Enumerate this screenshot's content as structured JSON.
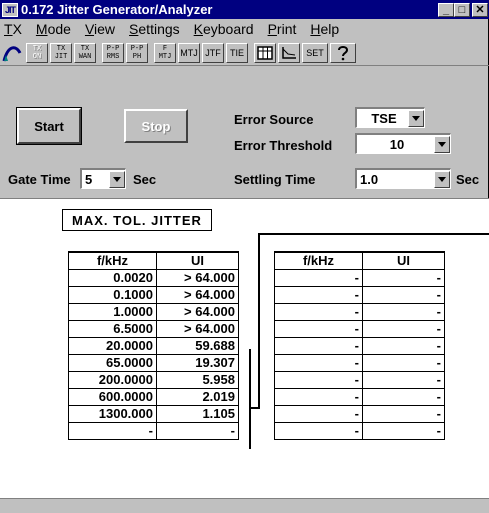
{
  "window": {
    "icon_text": "JIT",
    "title": "0.172 Jitter Generator/Analyzer"
  },
  "menu": {
    "items": [
      {
        "label": "TX"
      },
      {
        "label": "Mode"
      },
      {
        "label": "View"
      },
      {
        "label": "Settings"
      },
      {
        "label": "Keyboard"
      },
      {
        "label": "Print"
      },
      {
        "label": "Help"
      }
    ]
  },
  "toolbar": {
    "buttons": [
      {
        "line1": "TX",
        "line2": "ON",
        "disabled": true
      },
      {
        "line1": "TX",
        "line2": "JIT",
        "disabled": false
      },
      {
        "line1": "TX",
        "line2": "WAN",
        "disabled": false
      },
      {
        "line1": "P-P",
        "line2": "RMS",
        "disabled": false
      },
      {
        "line1": "P-P",
        "line2": "PH",
        "disabled": false
      },
      {
        "line1": "F",
        "line2": "MTJ",
        "disabled": false
      },
      {
        "line1": "",
        "line2": "MTJ",
        "disabled": false
      },
      {
        "line1": "",
        "line2": "JTF",
        "disabled": false
      },
      {
        "line1": "",
        "line2": "TIE",
        "disabled": false
      },
      {
        "line1": "",
        "line2": "SET",
        "disabled": false
      }
    ]
  },
  "controls": {
    "start_label": "Start",
    "stop_label": "Stop",
    "error_source_label": "Error Source",
    "error_source_value": "TSE",
    "error_threshold_label": "Error Threshold",
    "error_threshold_value": "10",
    "gate_time_label": "Gate Time",
    "gate_time_value": "5",
    "gate_time_unit": "Sec",
    "settling_time_label": "Settling Time",
    "settling_time_value": "1.0",
    "settling_time_unit": "Sec"
  },
  "result": {
    "caption": "MAX. TOL. JITTER",
    "left_table": {
      "headers": [
        "f/kHz",
        "UI"
      ],
      "rows": [
        [
          "0.0020",
          "> 64.000"
        ],
        [
          "0.1000",
          "> 64.000"
        ],
        [
          "1.0000",
          "> 64.000"
        ],
        [
          "6.5000",
          "> 64.000"
        ],
        [
          "20.0000",
          "59.688"
        ],
        [
          "65.0000",
          "19.307"
        ],
        [
          "200.0000",
          "5.958"
        ],
        [
          "600.0000",
          "2.019"
        ],
        [
          "1300.000",
          "1.105"
        ],
        [
          "-",
          "-"
        ]
      ]
    },
    "right_table": {
      "headers": [
        "f/kHz",
        "UI"
      ],
      "rows": [
        [
          "-",
          "-"
        ],
        [
          "-",
          "-"
        ],
        [
          "-",
          "-"
        ],
        [
          "-",
          "-"
        ],
        [
          "-",
          "-"
        ],
        [
          "-",
          "-"
        ],
        [
          "-",
          "-"
        ],
        [
          "-",
          "-"
        ],
        [
          "-",
          "-"
        ],
        [
          "-",
          "-"
        ]
      ]
    }
  }
}
